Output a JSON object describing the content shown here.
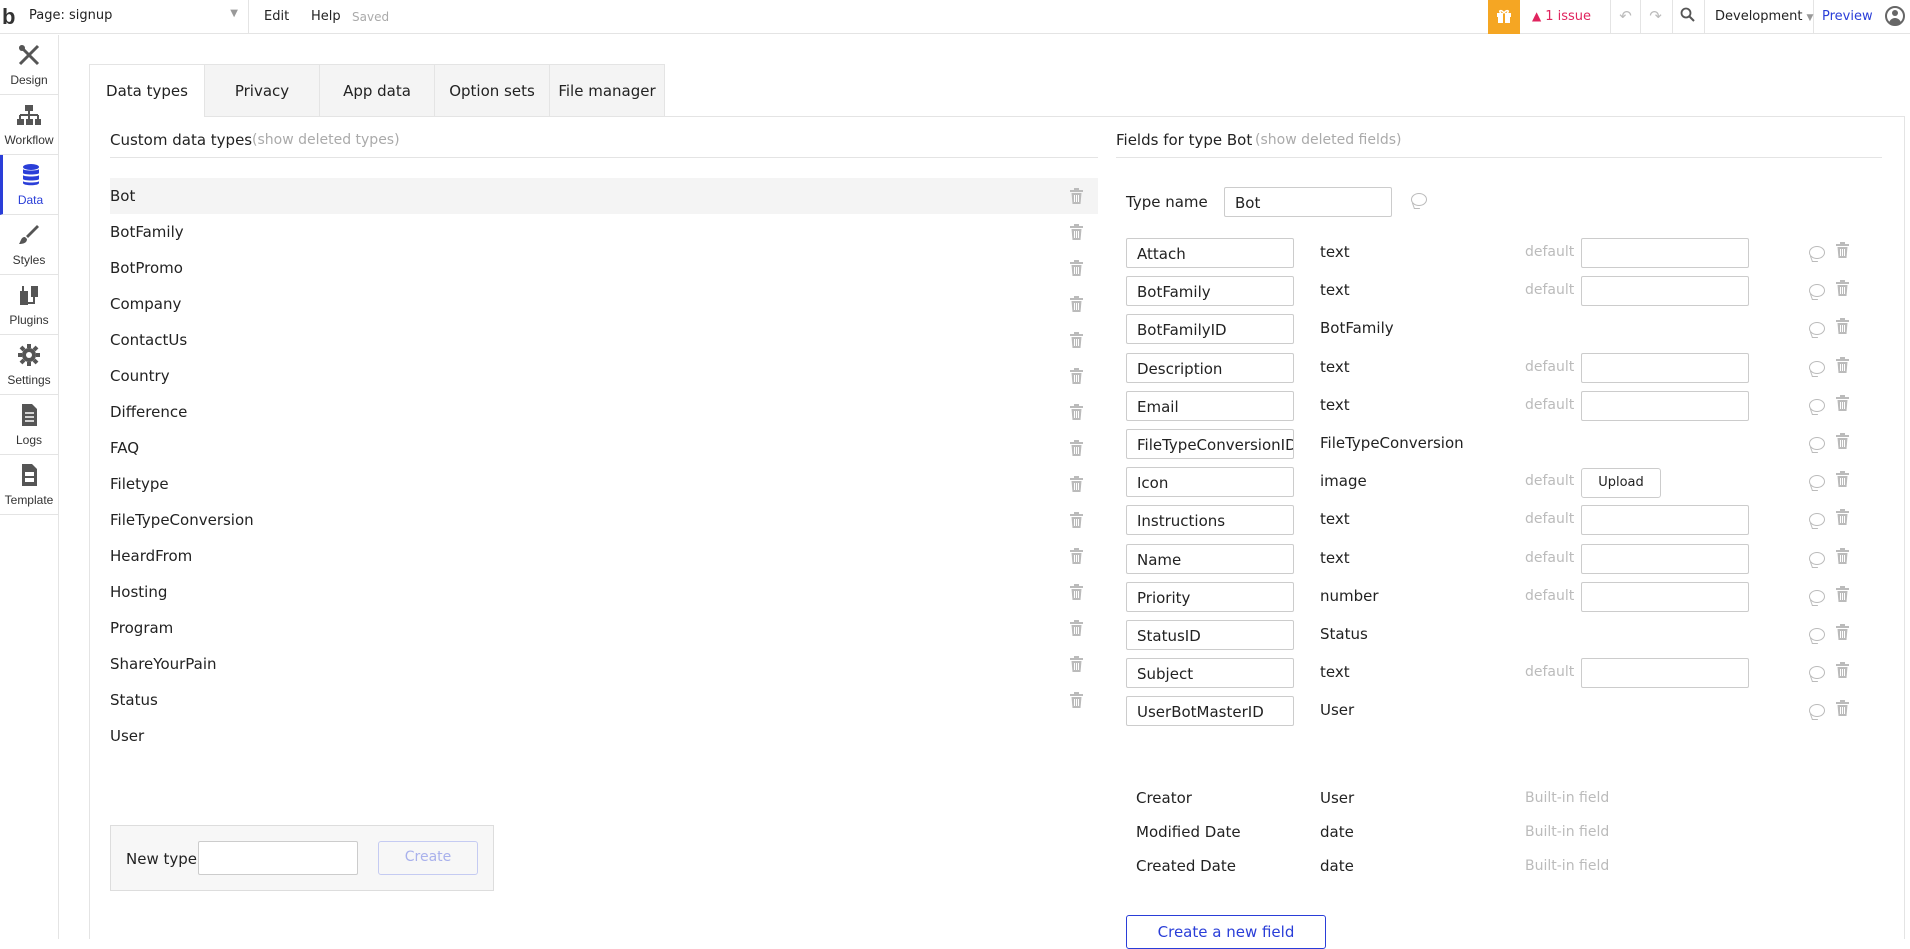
{
  "topbar": {
    "logo": "b",
    "page_select": "Page: signup",
    "menu": [
      "Edit",
      "Help"
    ],
    "status": "Saved",
    "issues": "1 issue",
    "environment": "Development",
    "preview": "Preview",
    "accent_color": "#2a3ed8",
    "issue_color": "#e0245e",
    "gift_color": "#f5a623"
  },
  "sidebar": {
    "items": [
      {
        "label": "Design",
        "icon": "design-icon"
      },
      {
        "label": "Workflow",
        "icon": "workflow-icon"
      },
      {
        "label": "Data",
        "icon": "database-icon",
        "active": true
      },
      {
        "label": "Styles",
        "icon": "brush-icon"
      },
      {
        "label": "Plugins",
        "icon": "plug-icon"
      },
      {
        "label": "Settings",
        "icon": "gear-icon"
      },
      {
        "label": "Logs",
        "icon": "document-icon"
      },
      {
        "label": "Template",
        "icon": "template-icon"
      }
    ]
  },
  "tabs": [
    "Data types",
    "Privacy",
    "App data",
    "Option sets",
    "File manager"
  ],
  "custom_types": {
    "title": "Custom data types",
    "show_deleted": "(show deleted types)",
    "items": [
      "Bot",
      "BotFamily",
      "BotPromo",
      "Company",
      "ContactUs",
      "Country",
      "Difference",
      "FAQ",
      "Filetype",
      "FileTypeConversion",
      "HeardFrom",
      "Hosting",
      "Program",
      "ShareYourPain",
      "Status",
      "User"
    ],
    "new_type_label": "New type",
    "create_label": "Create"
  },
  "fields": {
    "title": "Fields for type Bot",
    "show_deleted": "(show deleted fields)",
    "type_name_label": "Type name",
    "type_name_value": "Bot",
    "default_label": "default",
    "upload_label": "Upload",
    "items": [
      {
        "name": "Attach",
        "type": "text",
        "default": true
      },
      {
        "name": "BotFamily",
        "type": "text",
        "default": true
      },
      {
        "name": "BotFamilyID",
        "type": "BotFamily",
        "default": false
      },
      {
        "name": "Description",
        "type": "text",
        "default": true
      },
      {
        "name": "Email",
        "type": "text",
        "default": true
      },
      {
        "name": "FileTypeConversionID",
        "type": "FileTypeConversion",
        "default": false
      },
      {
        "name": "Icon",
        "type": "image",
        "default": true,
        "upload": true
      },
      {
        "name": "Instructions",
        "type": "text",
        "default": true
      },
      {
        "name": "Name",
        "type": "text",
        "default": true
      },
      {
        "name": "Priority",
        "type": "number",
        "default": true
      },
      {
        "name": "StatusID",
        "type": "Status",
        "default": false
      },
      {
        "name": "Subject",
        "type": "text",
        "default": true
      },
      {
        "name": "UserBotMasterID",
        "type": "User",
        "default": false
      }
    ],
    "builtin": [
      {
        "name": "Creator",
        "type": "User"
      },
      {
        "name": "Modified Date",
        "type": "date"
      },
      {
        "name": "Created Date",
        "type": "date"
      }
    ],
    "builtin_label": "Built-in field",
    "create_field_label": "Create a new field"
  }
}
